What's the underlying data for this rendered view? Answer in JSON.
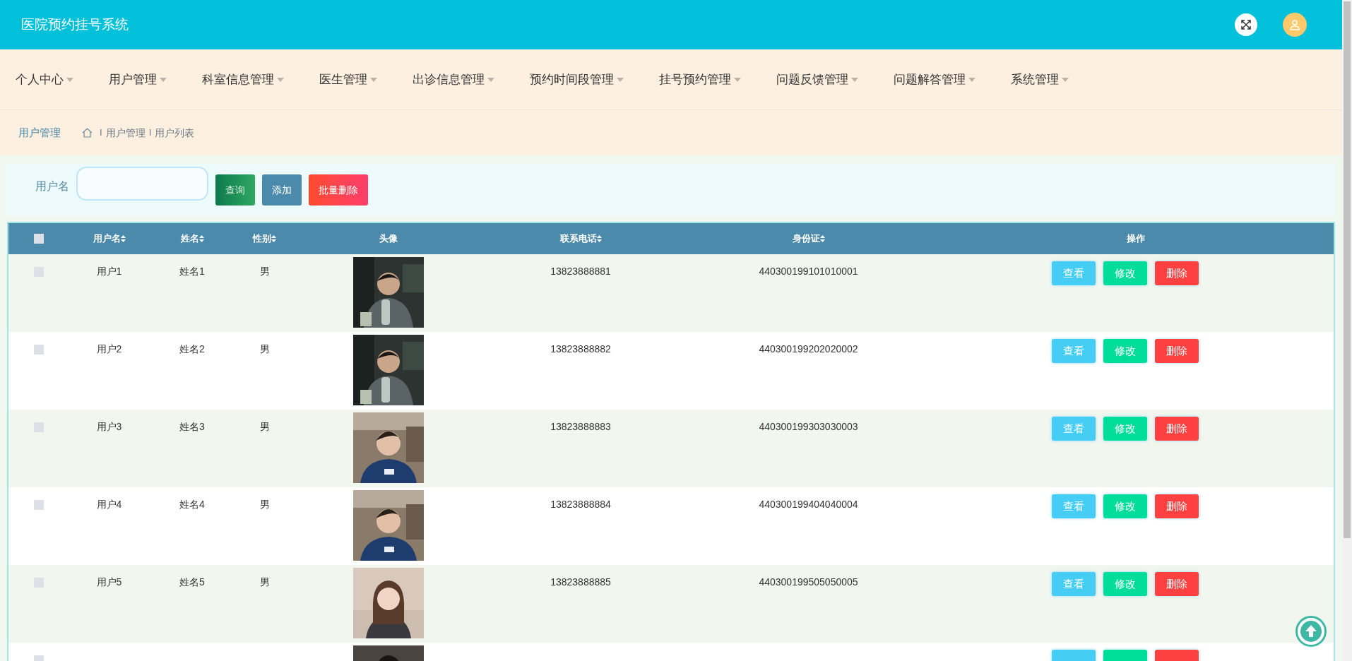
{
  "header": {
    "title": "医院预约挂号系统"
  },
  "nav": [
    {
      "label": "个人中心"
    },
    {
      "label": "用户管理"
    },
    {
      "label": "科室信息管理"
    },
    {
      "label": "医生管理"
    },
    {
      "label": "出诊信息管理"
    },
    {
      "label": "预约时间段管理"
    },
    {
      "label": "挂号预约管理"
    },
    {
      "label": "问题反馈管理"
    },
    {
      "label": "问题解答管理"
    },
    {
      "label": "系统管理"
    }
  ],
  "breadcrumb": {
    "title": "用户管理",
    "items": [
      {
        "separator": "I",
        "label": "用户管理"
      },
      {
        "separator": "I",
        "label": "用户列表"
      }
    ]
  },
  "search": {
    "label": "用户名",
    "buttons": [
      {
        "label": "查询",
        "kind": "search"
      },
      {
        "label": "添加",
        "kind": "add"
      },
      {
        "label": "批量删除",
        "kind": "delete"
      }
    ]
  },
  "table": {
    "select_all": {
      "checked": false
    },
    "columns": [
      {
        "label": "用户名",
        "sortable": true
      },
      {
        "label": "姓名",
        "sortable": true
      },
      {
        "label": "性别",
        "sortable": true
      },
      {
        "label": "头像",
        "sortable": false
      },
      {
        "label": "联系电话",
        "sortable": true
      },
      {
        "label": "身份证",
        "sortable": true
      },
      {
        "label": "操作",
        "sortable": false
      }
    ],
    "rows": [
      {
        "selected": false,
        "username": "用户1",
        "name": "姓名1",
        "gender": "男",
        "phone": "13823888881",
        "id_number": "440300199101010001",
        "actions": [
          {
            "label": "查看",
            "kind": "view"
          },
          {
            "label": "修改",
            "kind": "edit"
          },
          {
            "label": "删除",
            "kind": "delete"
          }
        ]
      },
      {
        "selected": false,
        "username": "用户2",
        "name": "姓名2",
        "gender": "男",
        "phone": "13823888882",
        "id_number": "440300199202020002",
        "actions": [
          {
            "label": "查看",
            "kind": "view"
          },
          {
            "label": "修改",
            "kind": "edit"
          },
          {
            "label": "删除",
            "kind": "delete"
          }
        ]
      },
      {
        "selected": false,
        "username": "用户3",
        "name": "姓名3",
        "gender": "男",
        "phone": "13823888883",
        "id_number": "440300199303030003",
        "actions": [
          {
            "label": "查看",
            "kind": "view"
          },
          {
            "label": "修改",
            "kind": "edit"
          },
          {
            "label": "删除",
            "kind": "delete"
          }
        ]
      },
      {
        "selected": false,
        "username": "用户4",
        "name": "姓名4",
        "gender": "男",
        "phone": "13823888884",
        "id_number": "440300199404040004",
        "actions": [
          {
            "label": "查看",
            "kind": "view"
          },
          {
            "label": "修改",
            "kind": "edit"
          },
          {
            "label": "删除",
            "kind": "delete"
          }
        ]
      },
      {
        "selected": false,
        "username": "用户5",
        "name": "姓名5",
        "gender": "男",
        "phone": "13823888885",
        "id_number": "440300199505050005",
        "actions": [
          {
            "label": "查看",
            "kind": "view"
          },
          {
            "label": "修改",
            "kind": "edit"
          },
          {
            "label": "删除",
            "kind": "delete"
          }
        ]
      },
      {
        "selected": false,
        "actions": [
          {
            "kind": "view"
          },
          {
            "kind": "edit"
          },
          {
            "kind": "delete"
          }
        ]
      }
    ]
  }
}
